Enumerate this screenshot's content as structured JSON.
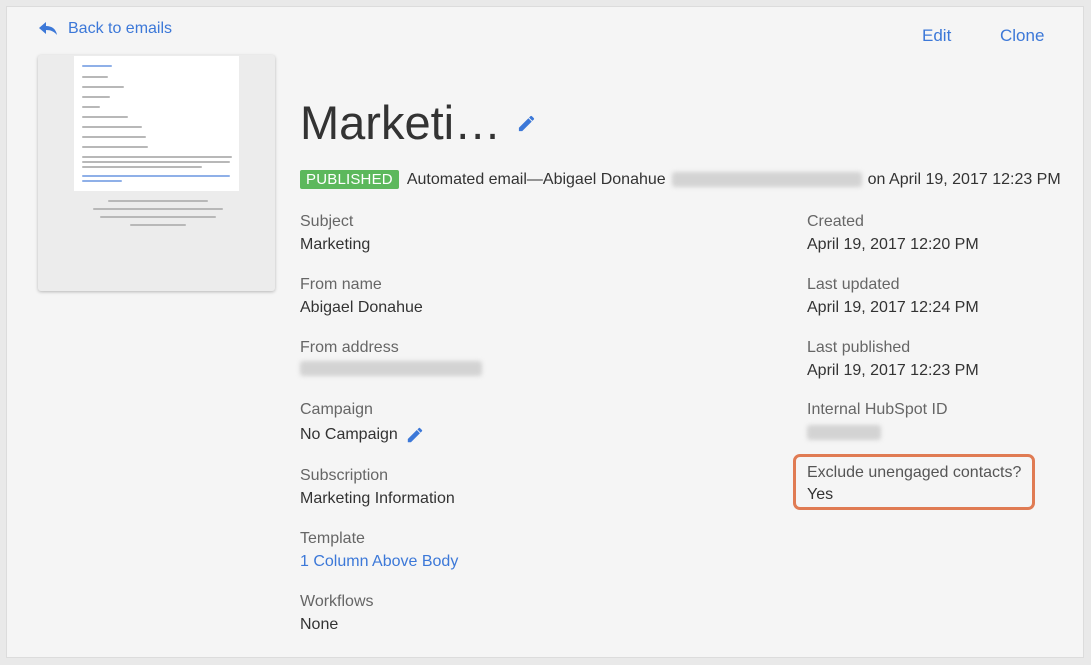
{
  "nav": {
    "back_label": "Back to emails",
    "edit_label": "Edit",
    "clone_label": "Clone"
  },
  "email": {
    "title": "Marketi…",
    "status_badge": "PUBLISHED",
    "status_text": "Automated email—Abigael Donahue",
    "published_on": "on April 19, 2017 12:23 PM"
  },
  "fields_left": [
    {
      "label": "Subject",
      "value": "Marketing"
    },
    {
      "label": "From name",
      "value": "Abigael Donahue"
    },
    {
      "label": "From address",
      "value": ""
    },
    {
      "label": "Campaign",
      "value": "No Campaign"
    },
    {
      "label": "Subscription",
      "value": "Marketing Information"
    },
    {
      "label": "Template",
      "value": "1 Column Above Body"
    },
    {
      "label": "Workflows",
      "value": "None"
    }
  ],
  "fields_right": [
    {
      "label": "Created",
      "value": "April 19, 2017 12:20 PM"
    },
    {
      "label": "Last updated",
      "value": "April 19, 2017 12:24 PM"
    },
    {
      "label": "Last published",
      "value": "April 19, 2017 12:23 PM"
    },
    {
      "label": "Internal HubSpot ID",
      "value": ""
    },
    {
      "label": "Exclude unengaged contacts?",
      "value": "Yes"
    }
  ],
  "colors": {
    "accent": "#3c78d8",
    "badge": "#5cb85c",
    "highlight": "#e07b53"
  },
  "icons": {
    "back": "reply-arrow-icon",
    "edit_title": "pencil-icon",
    "edit_campaign": "pencil-icon"
  }
}
